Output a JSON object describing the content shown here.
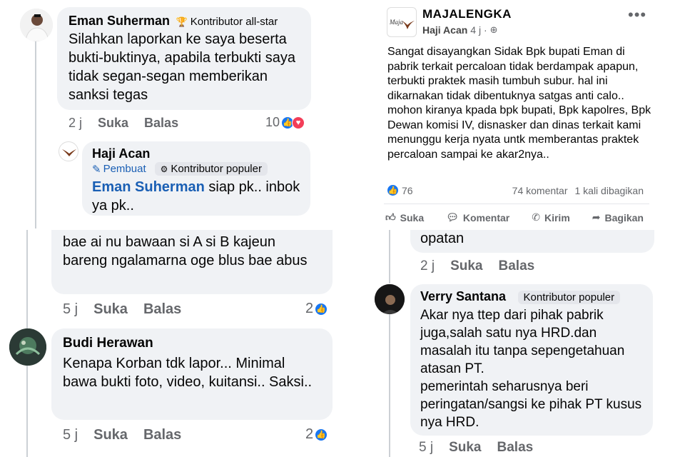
{
  "top_left": {
    "comment1": {
      "author": "Eman Suherman",
      "badge": "Kontributor all-star",
      "text": "Silahkan laporkan ke saya beserta bukti-buktinya, apabila terbukti saya tidak segan-segan memberikan sanksi tegas",
      "time": "2 j",
      "like": "Suka",
      "reply": "Balas",
      "reactions": "10"
    },
    "reply1": {
      "author": "Haji Acan",
      "badge_creator": "Pembuat",
      "badge_contrib": "Kontributor populer",
      "mention": "Eman Suherman",
      "text": "siap pk.. inbok ya pk.."
    }
  },
  "bottom_left": {
    "comment_partial": {
      "text": "bae ai nu bawaan si A si B kajeun bareng ngalamarna oge blus bae abus",
      "time": "5 j",
      "like": "Suka",
      "reply": "Balas",
      "reactions": "2"
    },
    "comment2": {
      "author": "Budi Herawan",
      "text": "Kenapa Korban tdk lapor... Minimal bawa bukti foto, video, kuitansi.. Saksi..",
      "time": "5 j",
      "like": "Suka",
      "reply": "Balas",
      "reactions": "2"
    }
  },
  "post": {
    "page_name": "MAJALENGKA",
    "logo_text": "Maja",
    "author": "Haji Acan",
    "time": "4 j ·",
    "body": "Sangat disayangkan Sidak Bpk bupati Eman di pabrik terkait percaloan tidak berdampak apapun, terbukti praktek masih tumbuh subur. hal ini dikarnakan tidak dibentuknya satgas anti calo.. mohon kiranya kpada bpk bupati, Bpk kapolres, Bpk Dewan komisi IV, disnasker dan dinas terkait kami menunggu kerja nyata untk memberantas praktek percaloan sampai ke akar2nya..",
    "like_count": "76",
    "comments": "74 komentar",
    "shares": "1 kali dibagikan",
    "actions": {
      "like": "Suka",
      "comment": "Komentar",
      "send": "Kirim",
      "share": "Bagikan"
    }
  },
  "bottom_right": {
    "comment_partial": {
      "text": "opatan",
      "time": "2 j",
      "like": "Suka",
      "reply": "Balas"
    },
    "comment3": {
      "author": "Verry Santana",
      "badge": "Kontributor populer",
      "text1": "Akar nya ttep dari pihak pabrik juga,salah satu nya HRD.dan masalah itu tanpa sepengetahuan atasan PT.",
      "text2": "pemerintah seharusnya beri peringatan/sangsi ke pihak PT kusus nya HRD.",
      "time": "5 j",
      "like": "Suka",
      "reply": "Balas"
    }
  },
  "colors": {
    "like_blue": "#1877f2",
    "love_red": "#f33e58",
    "bubble": "#f0f2f5",
    "mention": "#1a5fb4"
  }
}
